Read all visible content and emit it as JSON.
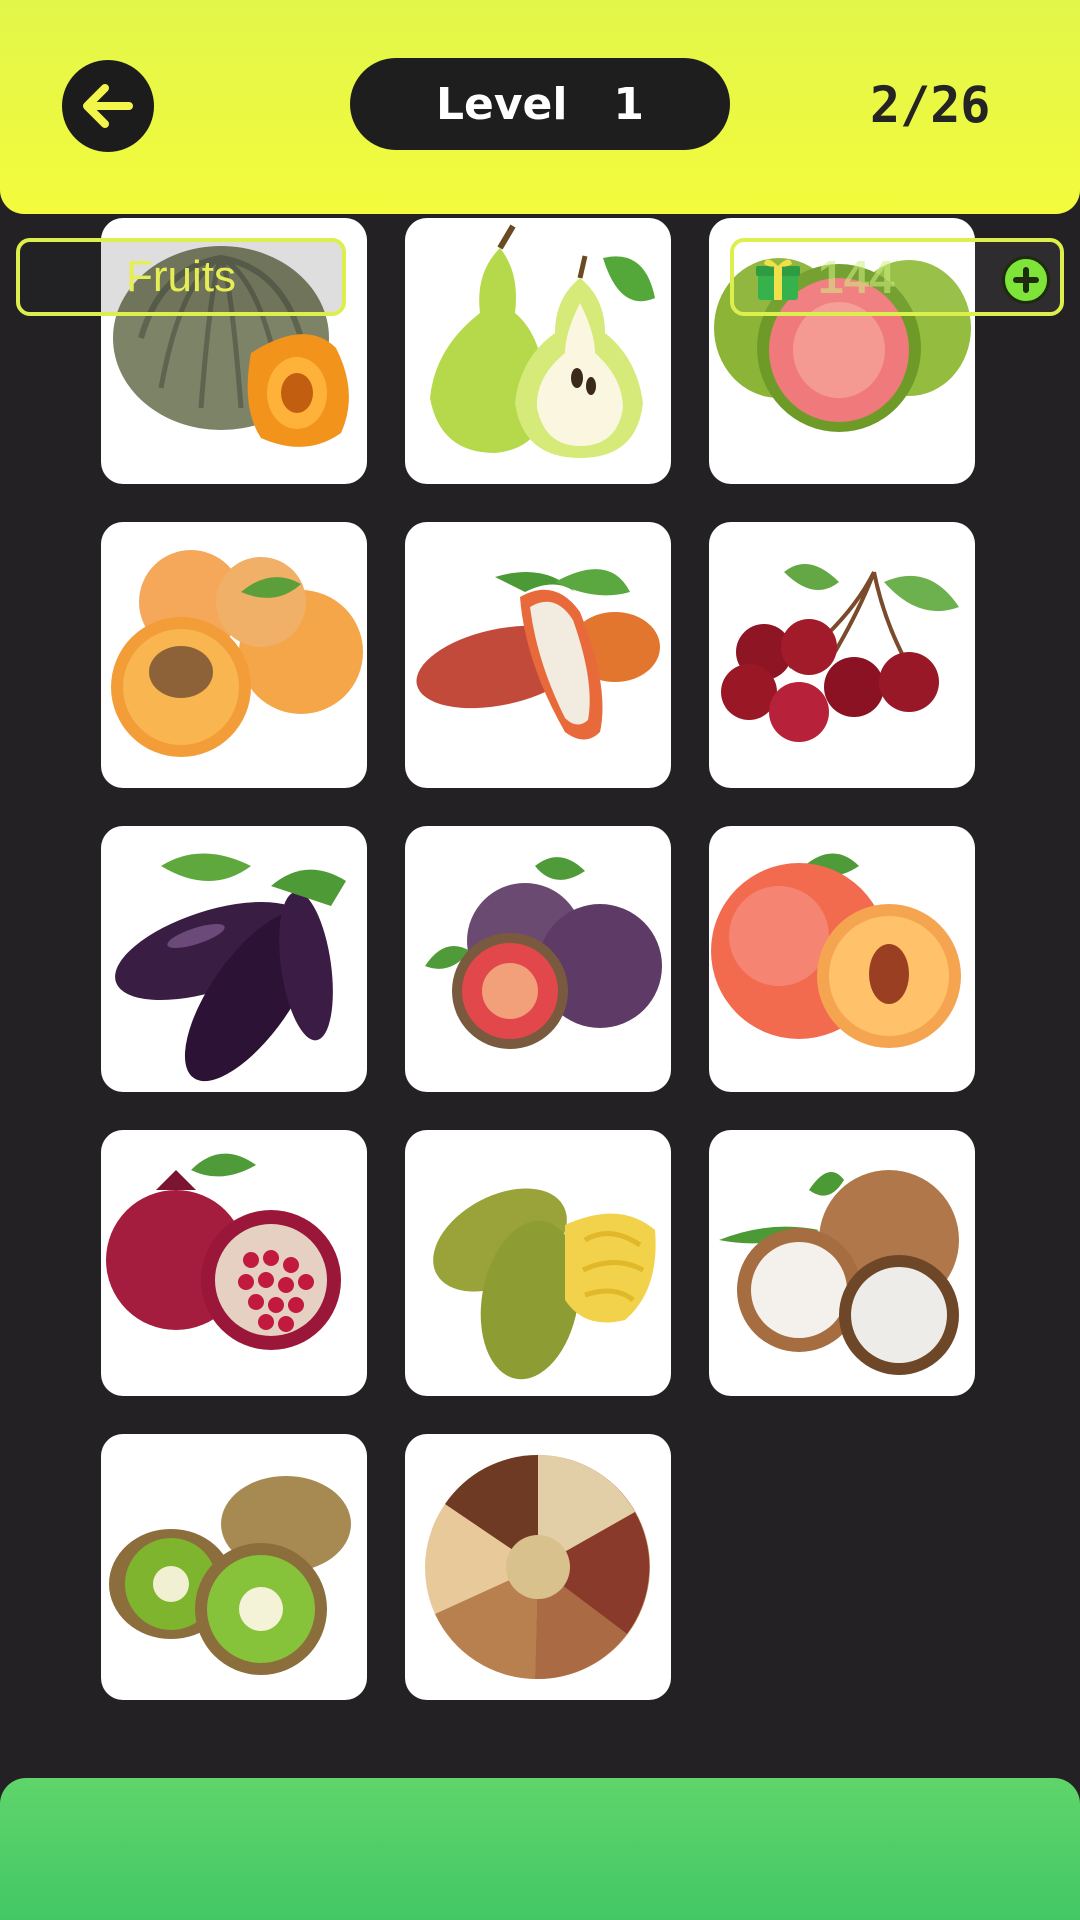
{
  "header": {
    "level_label": "Level",
    "level_number": "1",
    "progress": "2/26"
  },
  "hint": {
    "category": "Fruits",
    "coins": "144"
  },
  "icons": {
    "back": "arrow-left-icon",
    "coins": "gift-money-icon",
    "add": "plus-circle-icon"
  },
  "colors": {
    "header_bg": "#eef93f",
    "board_bg": "#232124",
    "bottom_bar": "#4ccb68",
    "accent": "#dcef4c"
  },
  "tiles": [
    {
      "name": "pumpkin"
    },
    {
      "name": "pear"
    },
    {
      "name": "guava"
    },
    {
      "name": "apricot"
    },
    {
      "name": "cacao-pod"
    },
    {
      "name": "cherry"
    },
    {
      "name": "eggplant"
    },
    {
      "name": "fig"
    },
    {
      "name": "peach"
    },
    {
      "name": "pomegranate"
    },
    {
      "name": "jackfruit"
    },
    {
      "name": "coconut"
    },
    {
      "name": "kiwi"
    },
    {
      "name": "mixed-nuts"
    }
  ]
}
